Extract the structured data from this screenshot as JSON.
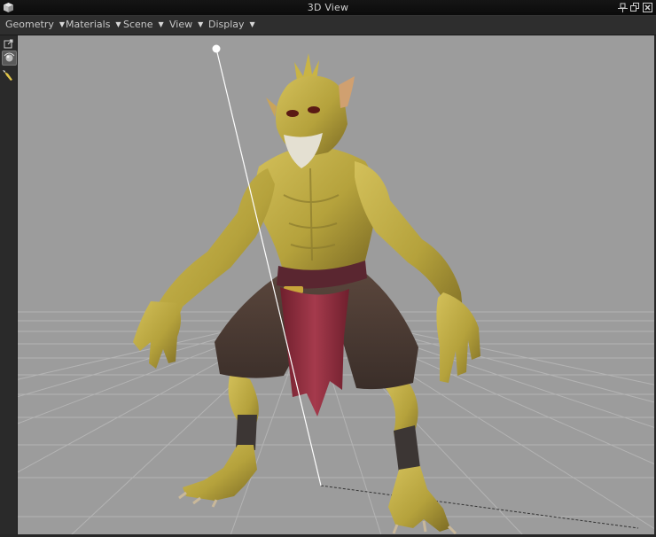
{
  "window": {
    "title": "3D View",
    "app_icon": "cube-icon",
    "buttons": [
      "pin-icon",
      "restore-icon",
      "close-icon"
    ]
  },
  "menubar": {
    "items": [
      {
        "label": "Geometry"
      },
      {
        "label": "Materials"
      },
      {
        "label": "Scene"
      },
      {
        "label": "View"
      },
      {
        "label": "Display"
      }
    ]
  },
  "toolbar": {
    "tools": [
      {
        "icon": "popout-icon"
      },
      {
        "icon": "rotate-camera-icon",
        "active": true
      },
      {
        "icon": "pen-icon"
      }
    ]
  },
  "viewport": {
    "background": "#9c9c9c",
    "grid_color": "#b4b4b4",
    "light_gizmo_color": "#ffffff",
    "model_name": "goblin-character",
    "skin_color": "#b5a23c",
    "shorts_color": "#4a3a33",
    "cloth_color": "#8a2a3a"
  }
}
